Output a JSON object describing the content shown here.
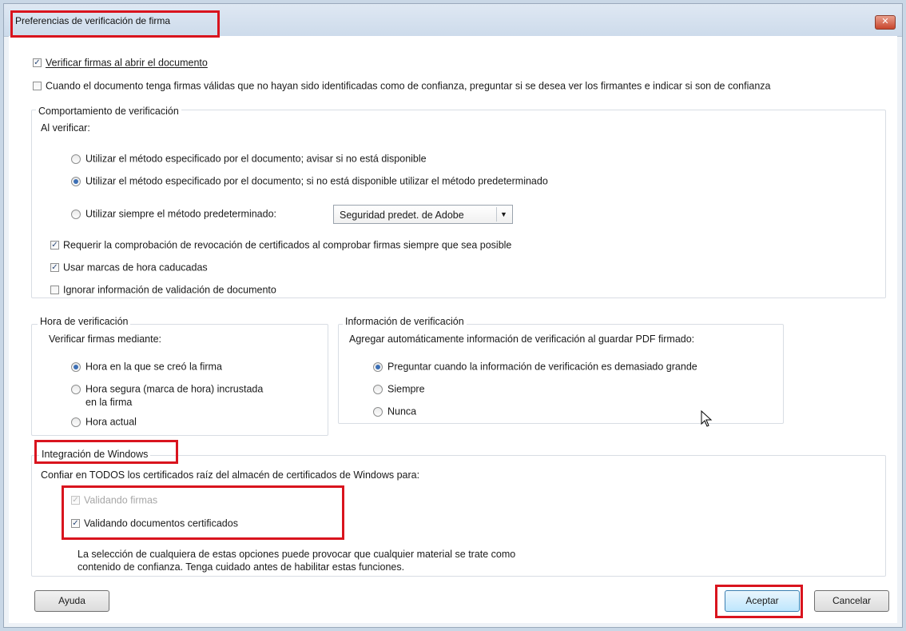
{
  "window": {
    "title": "Preferencias de verificación de firma",
    "close_label": "✕"
  },
  "top_checks": [
    {
      "label": "Verificar firmas al abrir el documento",
      "checked": true
    },
    {
      "label": "Cuando el documento tenga firmas válidas que no hayan sido identificadas como de confianza, preguntar si se desea ver los firmantes e indicar si son de confianza",
      "checked": false
    }
  ],
  "behavior": {
    "title": "Comportamiento de verificación",
    "subtitle": "Al verificar:",
    "radios": [
      {
        "label": "Utilizar el método especificado por el documento; avisar si no está disponible",
        "selected": false
      },
      {
        "label": "Utilizar el método especificado por el documento; si no está disponible utilizar el método predeterminado",
        "selected": true
      },
      {
        "label": "Utilizar siempre el método predeterminado:",
        "selected": false
      }
    ],
    "default_method": "Seguridad predet. de Adobe",
    "checks": [
      {
        "label": "Requerir la comprobación de revocación de certificados al comprobar firmas siempre que sea posible",
        "checked": true
      },
      {
        "label": "Usar marcas de hora caducadas",
        "checked": true
      },
      {
        "label": "Ignorar información de validación de documento",
        "checked": false
      }
    ]
  },
  "time": {
    "title": "Hora de verificación",
    "subtitle": "Verificar firmas mediante:",
    "radios": [
      {
        "label": "Hora en la que se creó la firma",
        "selected": true
      },
      {
        "label_line1": "Hora segura (marca de hora) incrustada",
        "label_line2": "en la firma",
        "selected": false
      },
      {
        "label": "Hora actual",
        "selected": false
      }
    ]
  },
  "info": {
    "title": "Información de verificación",
    "subtitle": "Agregar automáticamente información de verificación al guardar PDF firmado:",
    "radios": [
      {
        "label": "Preguntar cuando la información de verificación es demasiado grande",
        "selected": true
      },
      {
        "label": "Siempre",
        "selected": false
      },
      {
        "label": "Nunca",
        "selected": false
      }
    ]
  },
  "windows": {
    "title": "Integración de Windows",
    "subtitle": "Confiar en TODOS los certificados raíz del almacén de certificados de Windows para:",
    "checks": [
      {
        "label": "Validando firmas",
        "checked": true,
        "disabled": true
      },
      {
        "label": "Validando documentos certificados",
        "checked": true,
        "disabled": false
      }
    ],
    "note_line1": "La selección de cualquiera de estas opciones puede provocar que cualquier material se trate como",
    "note_line2": "contenido de confianza. Tenga cuidado antes de habilitar estas funciones."
  },
  "buttons": {
    "help": "Ayuda",
    "ok": "Aceptar",
    "cancel": "Cancelar"
  },
  "colors": {
    "highlight": "#d9141e",
    "radio_selected": "#3c6fb5"
  }
}
